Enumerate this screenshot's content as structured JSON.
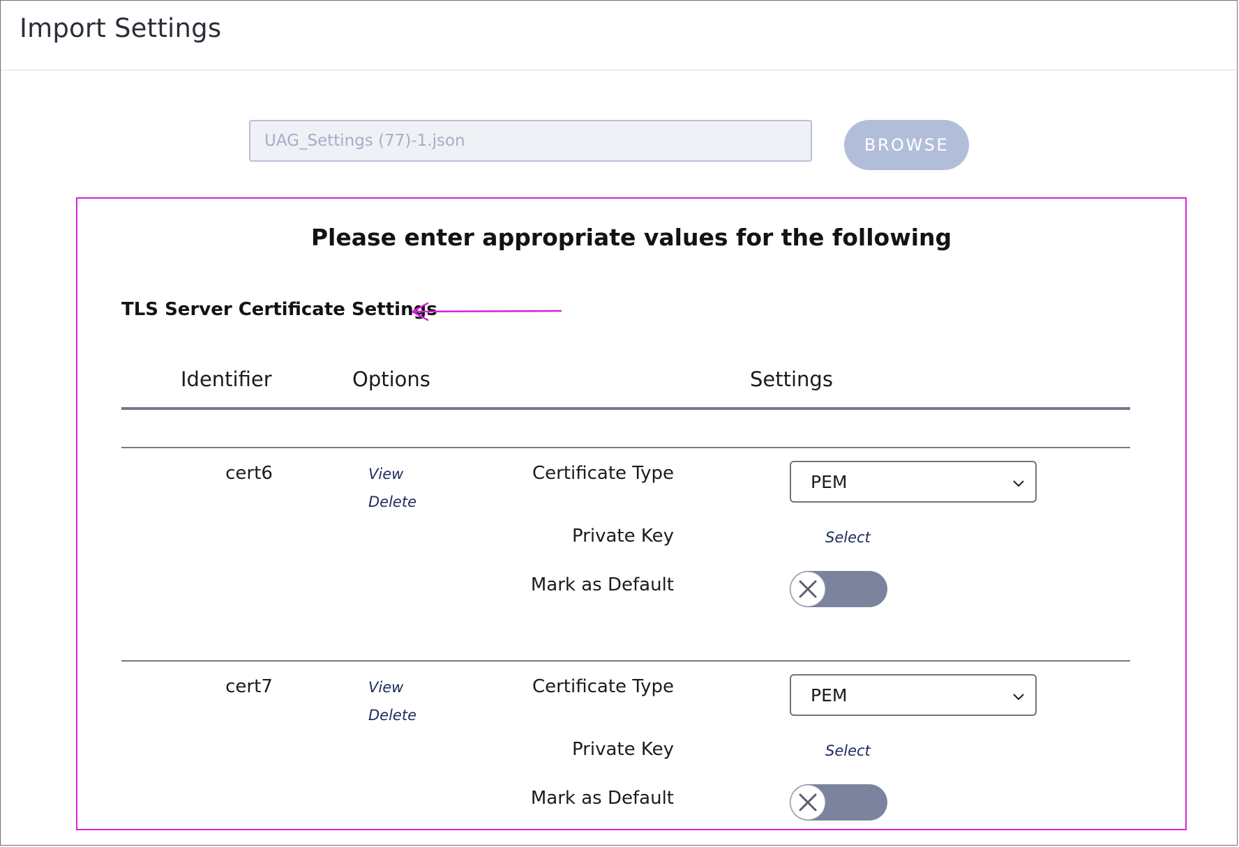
{
  "header": {
    "title": "Import Settings"
  },
  "file_upload": {
    "value": "UAG_Settings (77)-1.json",
    "browse_label": "BROWSE"
  },
  "panel": {
    "heading": "Please enter appropriate values for the following",
    "section_title": "TLS Server Certificate Settings",
    "columns": {
      "identifier": "Identifier",
      "options": "Options",
      "settings": "Settings"
    },
    "rows": [
      {
        "identifier": "cert6",
        "view_label": "View",
        "delete_label": "Delete",
        "cert_type_label": "Certificate Type",
        "cert_type_value": "PEM",
        "private_key_label": "Private Key",
        "private_key_action": "Select",
        "mark_default_label": "Mark as Default",
        "mark_default_on": false
      },
      {
        "identifier": "cert7",
        "view_label": "View",
        "delete_label": "Delete",
        "cert_type_label": "Certificate Type",
        "cert_type_value": "PEM",
        "private_key_label": "Private Key",
        "private_key_action": "Select",
        "mark_default_label": "Mark as Default",
        "mark_default_on": false
      }
    ]
  },
  "colors": {
    "highlight": "#d623d6",
    "link": "#1d2a5c",
    "toggle_off": "#7b849c",
    "browse_disabled": "#b2bed9"
  },
  "icons": {
    "arrow": "arrow-left-icon",
    "chevron": "chevron-down-icon",
    "toggle_knob": "close-icon"
  }
}
